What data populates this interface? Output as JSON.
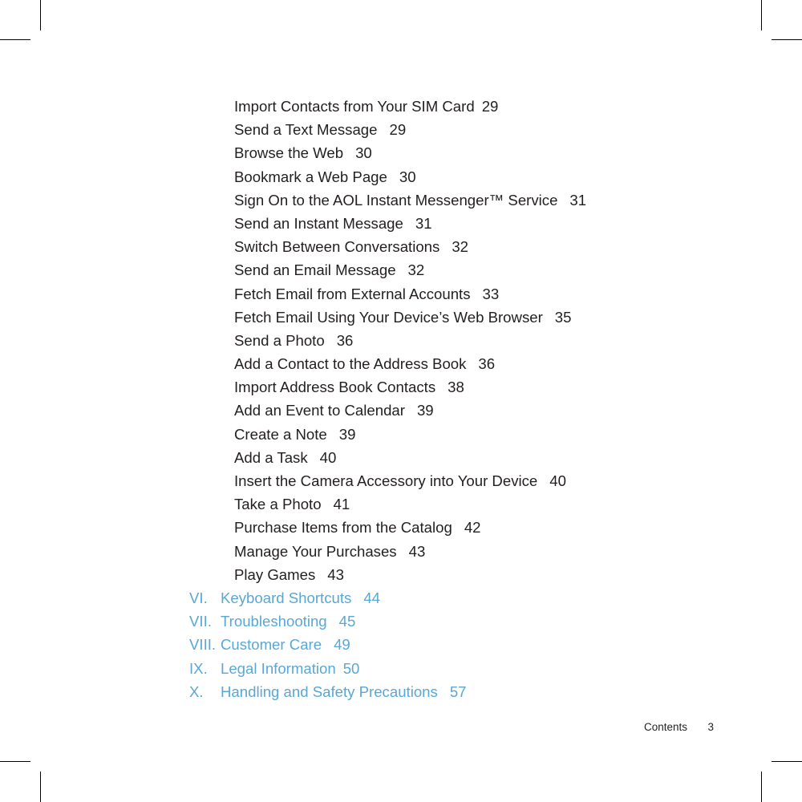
{
  "document": {
    "section_title": "Contents",
    "footer": {
      "label": "Contents",
      "page_number": "3"
    },
    "colors": {
      "body_text": "#231f20",
      "part_heading": "#5aa7d4",
      "crop_mark": "#000000",
      "background": "#ffffff"
    }
  },
  "toc": {
    "sub_entries": [
      {
        "title": "Import Contacts from Your SIM Card",
        "page": "29",
        "gap": "2"
      },
      {
        "title": "Send a Text Message",
        "page": "29",
        "gap": "3"
      },
      {
        "title": "Browse the Web",
        "page": "30",
        "gap": "3"
      },
      {
        "title": "Bookmark a Web Page",
        "page": "30",
        "gap": "3"
      },
      {
        "title": "Sign On to the AOL Instant Messenger™ Service",
        "page": "31",
        "gap": "3"
      },
      {
        "title": "Send an Instant Message",
        "page": "31",
        "gap": "3"
      },
      {
        "title": "Switch Between Conversations",
        "page": "32",
        "gap": "3"
      },
      {
        "title": "Send an Email Message",
        "page": "32",
        "gap": "3"
      },
      {
        "title": "Fetch Email from External Accounts",
        "page": "33",
        "gap": "3"
      },
      {
        "title": "Fetch Email Using Your Device’s Web Browser",
        "page": "35",
        "gap": "3"
      },
      {
        "title": "Send a Photo",
        "page": "36",
        "gap": "3"
      },
      {
        "title": "Add a Contact to the Address Book",
        "page": "36",
        "gap": "3"
      },
      {
        "title": "Import Address Book Contacts",
        "page": "38",
        "gap": "3"
      },
      {
        "title": "Add an Event to Calendar",
        "page": "39",
        "gap": "3"
      },
      {
        "title": "Create a Note",
        "page": "39",
        "gap": "3"
      },
      {
        "title": "Add a Task",
        "page": "40",
        "gap": "3"
      },
      {
        "title": "Insert the Camera Accessory into Your Device",
        "page": "40",
        "gap": "3"
      },
      {
        "title": "Take a Photo",
        "page": "41",
        "gap": "3"
      },
      {
        "title": "Purchase Items from the Catalog",
        "page": "42",
        "gap": "3"
      },
      {
        "title": "Manage Your Purchases",
        "page": "43",
        "gap": "3"
      },
      {
        "title": "Play Games",
        "page": "43",
        "gap": "3"
      }
    ],
    "part_entries": [
      {
        "numeral": "VI.",
        "title": "Keyboard Shortcuts",
        "page": "44",
        "gap": "3"
      },
      {
        "numeral": "VII.",
        "title": "Troubleshooting",
        "page": "45",
        "gap": "3"
      },
      {
        "numeral": "VIII.",
        "title": "Customer Care",
        "page": "49",
        "gap": "3"
      },
      {
        "numeral": "IX.",
        "title": "Legal Information",
        "page": "50",
        "gap": "2"
      },
      {
        "numeral": "X.",
        "title": "Handling and Safety Precautions",
        "page": "57",
        "gap": "3"
      }
    ]
  }
}
